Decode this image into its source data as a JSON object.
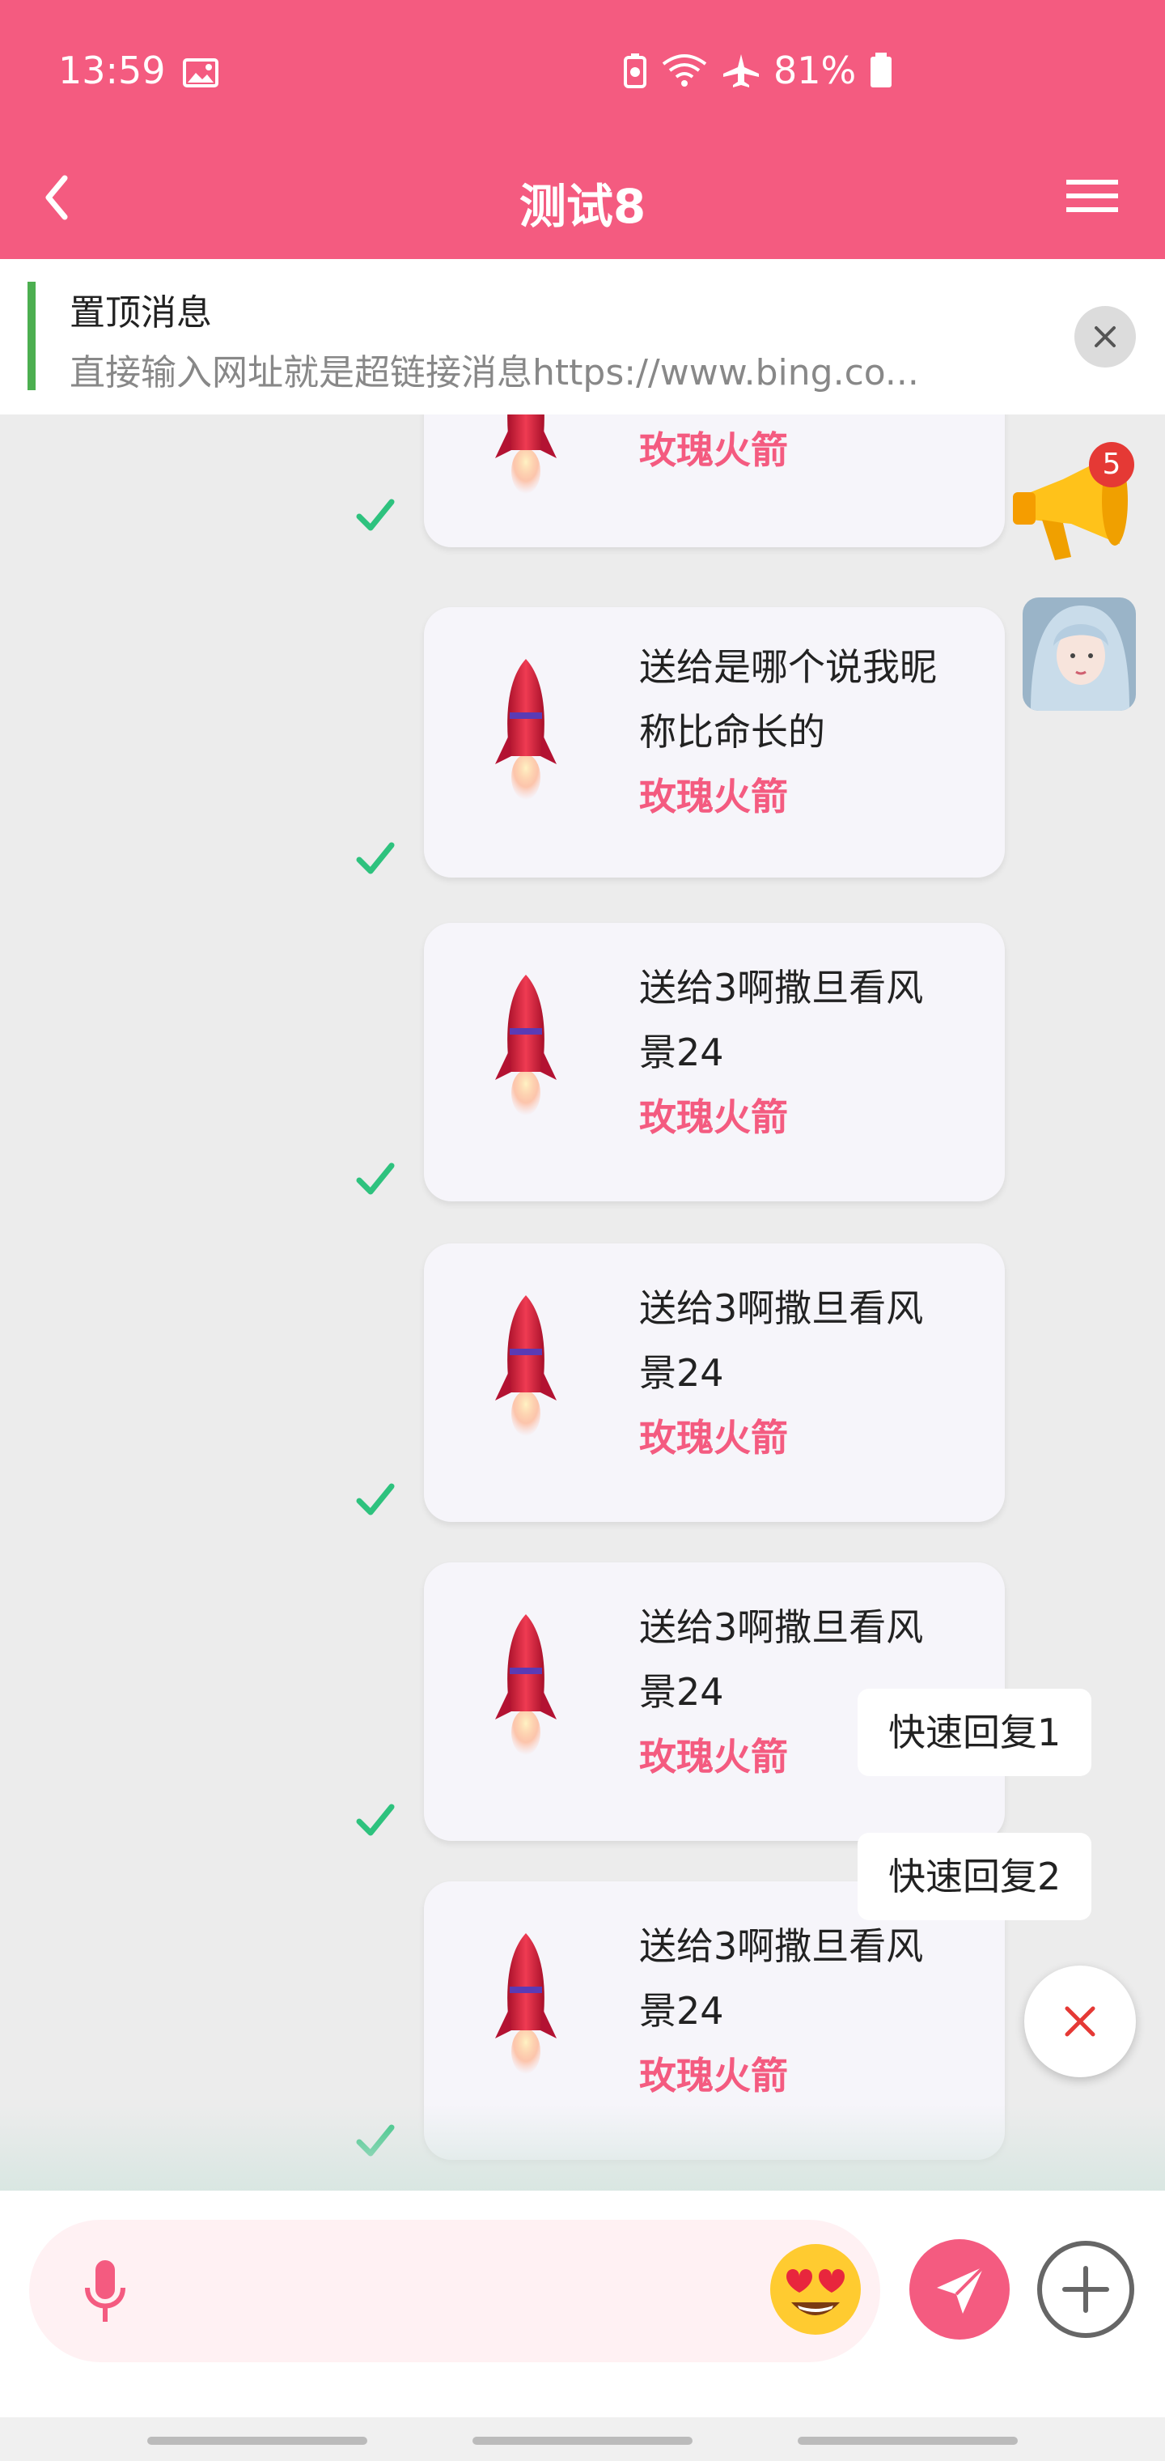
{
  "status": {
    "time": "13:59",
    "battery": "81%"
  },
  "header": {
    "title": "测试8"
  },
  "pinned": {
    "title": "置顶消息",
    "text": "直接输入网址就是超链接消息https://www.bing.co..."
  },
  "messages": [
    {
      "line1": "",
      "line2": "",
      "gift": "玫瑰火箭"
    },
    {
      "line1": "送给是哪个说我昵",
      "line2": "称比命长的",
      "gift": "玫瑰火箭"
    },
    {
      "line1": "送给3啊撒旦看风",
      "line2": "景24",
      "gift": "玫瑰火箭"
    },
    {
      "line1": "送给3啊撒旦看风",
      "line2": "景24",
      "gift": "玫瑰火箭"
    },
    {
      "line1": "送给3啊撒旦看风",
      "line2": "景24",
      "gift": "玫瑰火箭"
    },
    {
      "line1": "送给3啊撒旦看风",
      "line2": "景24",
      "gift": "玫瑰火箭"
    }
  ],
  "announcement": {
    "badge": "5"
  },
  "quick_replies": [
    "快速回复1",
    "快速回复2"
  ],
  "colors": {
    "primary": "#f45b80",
    "check": "#2ec27e",
    "pin_bar": "#4caf50"
  }
}
